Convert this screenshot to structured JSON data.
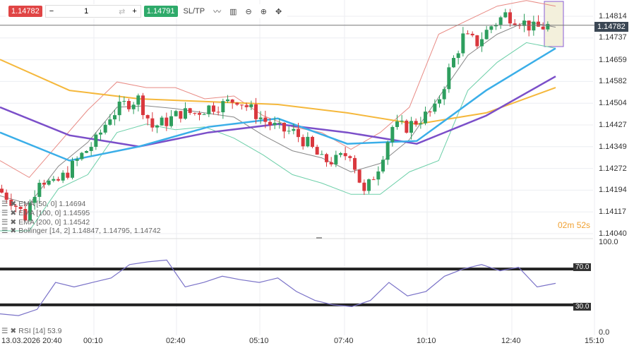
{
  "toolbar": {
    "sell_price": "1.14782",
    "minus": "−",
    "quantity": "1",
    "plus": "+",
    "buy_price": "1.14791",
    "sltp": "SL/TP"
  },
  "price_axis": [
    "1.14814",
    "1.14737",
    "1.14659",
    "1.14582",
    "1.14504",
    "1.14427",
    "1.14349",
    "1.14272",
    "1.14194",
    "1.14117",
    "1.14040"
  ],
  "current_price": "1.14782",
  "countdown": {
    "min": "02m",
    "sec": "52s"
  },
  "time_axis": [
    "13.03.2026 20:40",
    "00:10",
    "02:40",
    "05:10",
    "07:40",
    "10:10",
    "12:40",
    "15:10"
  ],
  "legends": [
    "EMA [50, 0] 1.14694",
    "EMA [100, 0] 1.14595",
    "EMA [200, 0] 1.14542",
    "Bollinger [14, 2] 1.14847, 1.14795, 1.14742"
  ],
  "rsi": {
    "legend": "RSI [14] 53.9",
    "axis": [
      "100.0",
      "70.0",
      "30.0",
      "0.0"
    ],
    "levels": [
      70,
      30
    ]
  },
  "colors": {
    "up": "#2e9e5e",
    "down": "#d9383e",
    "ema50": "#3aaee8",
    "ema100": "#7b4fc9",
    "ema200": "#f5b83c",
    "bb_upper": "#e88a84",
    "bb_lower": "#6ccfa8",
    "bb_mid": "#888888",
    "rsi": "#7a72c8",
    "countdown": "#f0a030"
  },
  "chart_data": {
    "type": "candlestick",
    "closes": [
      1.142,
      1.1416,
      1.141,
      1.1424,
      1.1421,
      1.1426,
      1.1432,
      1.1437,
      1.1446,
      1.145,
      1.1452,
      1.1442,
      1.1444,
      1.1447,
      1.1447,
      1.1449,
      1.145,
      1.1452,
      1.1448,
      1.1444,
      1.1441,
      1.144,
      1.1436,
      1.143,
      1.143,
      1.1433,
      1.1418,
      1.1428,
      1.1442,
      1.1442,
      1.1445,
      1.1448,
      1.1462,
      1.1474,
      1.1472,
      1.1478,
      1.1482,
      1.148,
      1.1477,
      1.1478
    ],
    "ema200": [
      1.1466,
      1.1455,
      1.1452,
      1.1451,
      1.145,
      1.1447,
      1.1443,
      1.1447,
      1.1456
    ],
    "ema100": [
      1.1449,
      1.1439,
      1.1435,
      1.144,
      1.1443,
      1.144,
      1.1436,
      1.1446,
      1.146
    ],
    "ema50": [
      1.144,
      1.143,
      1.1435,
      1.1442,
      1.1445,
      1.1436,
      1.1437,
      1.1455,
      1.147
    ],
    "bb_upper": [
      1.143,
      1.1424,
      1.1436,
      1.1448,
      1.1458,
      1.1456,
      1.1456,
      1.1452,
      1.1453,
      1.1446,
      1.1442,
      1.144,
      1.1434,
      1.144,
      1.1449,
      1.1475,
      1.148,
      1.1485,
      1.1487,
      1.1485
    ],
    "bb_lower": [
      1.1405,
      1.1405,
      1.142,
      1.1425,
      1.144,
      1.1443,
      1.1441,
      1.1442,
      1.1438,
      1.1432,
      1.1425,
      1.1422,
      1.1418,
      1.1418,
      1.1426,
      1.143,
      1.1455,
      1.1465,
      1.1472,
      1.147
    ],
    "rsi": [
      20,
      18,
      25,
      55,
      50,
      55,
      60,
      75,
      78,
      80,
      50,
      55,
      62,
      58,
      55,
      60,
      45,
      35,
      30,
      28,
      35,
      55,
      40,
      45,
      62,
      70,
      75,
      68,
      72,
      50,
      54
    ],
    "ylim": [
      1.1404,
      1.14814
    ]
  }
}
